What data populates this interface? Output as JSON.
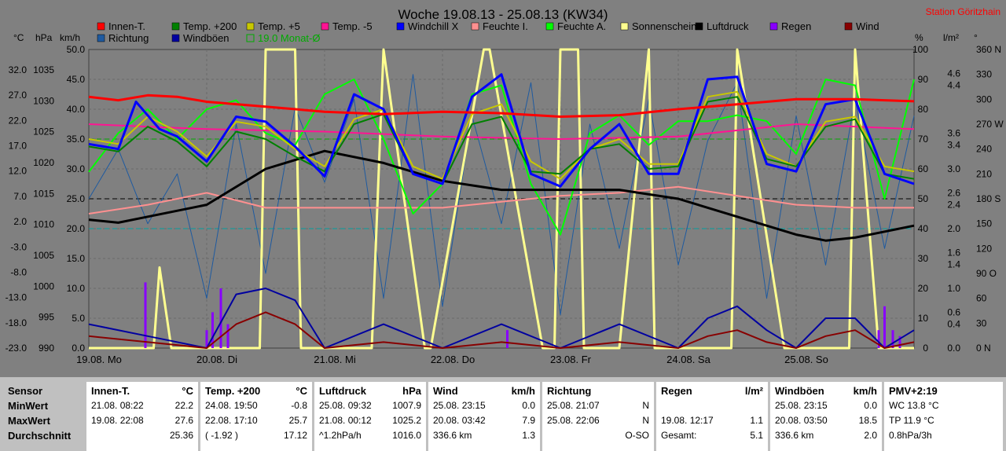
{
  "chart_data": {
    "type": "line",
    "title": "Woche 19.08.13 - 25.08.13 (KW34)",
    "station": "Station Göritzhain",
    "axis_units": {
      "celsius": "°C",
      "hpa": "hPa",
      "kmh": "km/h",
      "percent": "%",
      "lm2": "l/m²",
      "deg": "°"
    },
    "axes": {
      "celsius": [
        "32.0",
        "27.0",
        "22.0",
        "17.0",
        "12.0",
        "7.0",
        "2.0",
        "-3.0",
        "-8.0",
        "-13.0",
        "-18.0",
        "-23.0"
      ],
      "hpa": [
        "1035",
        "1030",
        "1025",
        "1020",
        "1015",
        "1010",
        "1005",
        "1000",
        "995",
        "990"
      ],
      "kmh": [
        "50.0",
        "45.0",
        "40.0",
        "35.0",
        "30.0",
        "25.0",
        "20.0",
        "15.0",
        "10.0",
        "5.0",
        "0.0"
      ],
      "percent": [
        "100",
        "90",
        "80",
        "70",
        "60",
        "50",
        "40",
        "30",
        "20",
        "10",
        "0"
      ],
      "lm2": [
        "4.6",
        "4.4",
        "3.6",
        "3.4",
        "3.0",
        "2.6",
        "2.4",
        "2.0",
        "1.6",
        "1.4",
        "1.0",
        "0.6",
        "0.4",
        "0.0"
      ],
      "direction": [
        "360 N",
        "330",
        "300",
        "270 W",
        "240",
        "210",
        "180 S",
        "150",
        "120",
        "90 O",
        "60",
        "30",
        "0 N"
      ]
    },
    "x_days": [
      "19.08. Mo",
      "20.08. Di",
      "21.08. Mi",
      "22.08. Do",
      "23.08. Fr",
      "24.08. Sa",
      "25.08. So"
    ],
    "legend": [
      {
        "name": "Innen-T.",
        "color": "#ff0000"
      },
      {
        "name": "Temp. +200",
        "color": "#008000"
      },
      {
        "name": "Temp. +5",
        "color": "#c8c800"
      },
      {
        "name": "Temp. -5",
        "color": "#ff1493"
      },
      {
        "name": "Windchill X",
        "color": "#0000ff"
      },
      {
        "name": "Feuchte I.",
        "color": "#ff9090"
      },
      {
        "name": "Feuchte A.",
        "color": "#00ff00"
      },
      {
        "name": "Sonnenschein",
        "color": "#ffff90"
      },
      {
        "name": "Luftdruck",
        "color": "#000000"
      },
      {
        "name": "Regen",
        "color": "#8800ff"
      },
      {
        "name": "Wind",
        "color": "#880000"
      },
      {
        "name": "Richtung",
        "color": "#1e5aa0"
      },
      {
        "name": "Windböen",
        "color": "#0000a0"
      },
      {
        "name": "19.0 Monat-Ø",
        "color": "#00aa00"
      }
    ],
    "x_unit": "day",
    "series": [
      {
        "name": "Innen-T.",
        "unit": "°C",
        "x": [
          0,
          0.25,
          0.5,
          0.75,
          1,
          1.5,
          2,
          2.5,
          3,
          3.5,
          4,
          4.5,
          5,
          5.5,
          6,
          6.25,
          6.5,
          6.75,
          7
        ],
        "values": [
          27.5,
          26.8,
          27.8,
          27.5,
          26.5,
          25.5,
          24.5,
          24.0,
          24.5,
          24.2,
          23.5,
          23.8,
          25.0,
          26.0,
          27.0,
          27.0,
          27.0,
          26.8,
          26.6
        ]
      },
      {
        "name": "Temp. +200",
        "unit": "°C",
        "x": [
          0,
          0.25,
          0.5,
          0.75,
          1,
          1.25,
          1.5,
          1.75,
          2,
          2.25,
          2.5,
          2.75,
          3,
          3.25,
          3.5,
          3.75,
          4,
          4.25,
          4.5,
          4.75,
          5,
          5.25,
          5.5,
          5.75,
          6,
          6.25,
          6.5,
          6.75,
          7
        ],
        "values": [
          17.5,
          16.5,
          21.5,
          18.5,
          13.5,
          20.5,
          19.0,
          15.5,
          12.5,
          22.0,
          24.0,
          12.0,
          10.0,
          22.0,
          23.5,
          12.5,
          12.0,
          17.0,
          18.0,
          13.0,
          13.5,
          26.5,
          27.5,
          15.0,
          13.5,
          21.5,
          23.0,
          12.0,
          11.0
        ]
      },
      {
        "name": "Temp. +5",
        "unit": "°C",
        "x": [
          0,
          0.25,
          0.5,
          0.75,
          1,
          1.25,
          1.5,
          1.75,
          2,
          2.25,
          2.5,
          2.75,
          3,
          3.25,
          3.5,
          3.75,
          4,
          4.25,
          4.5,
          4.75,
          5,
          5.25,
          5.5,
          5.75,
          6,
          6.25,
          6.5,
          6.75,
          7
        ],
        "values": [
          19.0,
          18.0,
          23.5,
          20.5,
          15.5,
          22.5,
          21.5,
          17.0,
          13.5,
          23.0,
          25.0,
          13.5,
          11.0,
          24.0,
          26.0,
          14.5,
          11.0,
          17.0,
          19.0,
          14.0,
          14.0,
          27.5,
          28.5,
          16.0,
          13.5,
          22.5,
          23.5,
          13.5,
          12.5
        ]
      },
      {
        "name": "Temp. -5",
        "unit": "°C",
        "x": [
          0,
          1,
          2,
          3,
          4,
          5,
          6,
          7
        ],
        "values": [
          22.0,
          21.0,
          20.5,
          19.5,
          19.0,
          19.5,
          22.0,
          21.0
        ]
      },
      {
        "name": "Windchill X",
        "unit": "°C",
        "x": [
          0,
          0.25,
          0.4,
          0.6,
          0.75,
          1,
          1.25,
          1.5,
          1.75,
          2,
          2.25,
          2.5,
          2.75,
          3,
          3.25,
          3.5,
          3.75,
          4,
          4.25,
          4.5,
          4.75,
          5,
          5.25,
          5.5,
          5.75,
          6,
          6.25,
          6.5,
          6.75,
          7
        ],
        "values": [
          18.0,
          17.0,
          26.5,
          21.0,
          19.5,
          14.5,
          23.5,
          22.5,
          17.5,
          11.5,
          28.0,
          25.0,
          12.0,
          10.0,
          27.5,
          32.0,
          12.0,
          9.5,
          17.0,
          22.0,
          12.0,
          12.0,
          31.0,
          31.5,
          14.0,
          12.5,
          26.0,
          27.0,
          12.0,
          10.0
        ]
      },
      {
        "name": "Feuchte I.",
        "unit": "%",
        "x": [
          0,
          0.5,
          1,
          1.5,
          2,
          2.5,
          3,
          3.5,
          4,
          4.5,
          5,
          5.5,
          6,
          6.5,
          7
        ],
        "values": [
          45,
          48,
          52,
          47,
          47,
          47,
          47,
          49,
          51,
          52,
          54,
          51,
          48,
          47,
          47
        ]
      },
      {
        "name": "Feuchte A.",
        "unit": "%",
        "x": [
          0,
          0.25,
          0.5,
          0.75,
          1,
          1.25,
          1.5,
          1.75,
          2,
          2.25,
          2.5,
          2.75,
          3,
          3.25,
          3.5,
          3.75,
          4,
          4.25,
          4.5,
          4.75,
          5,
          5.25,
          5.5,
          5.75,
          6,
          6.25,
          6.5,
          6.75,
          7
        ],
        "values": [
          59,
          72,
          80,
          70,
          80,
          83,
          72,
          68,
          85,
          90,
          70,
          45,
          55,
          85,
          88,
          55,
          38,
          72,
          78,
          68,
          76,
          76,
          78,
          76,
          65,
          90,
          88,
          50,
          90
        ]
      },
      {
        "name": "Luftdruck",
        "unit": "hPa",
        "x": [
          0,
          0.25,
          0.5,
          1,
          1.5,
          2,
          2.5,
          3,
          3.5,
          4,
          4.5,
          5,
          5.5,
          6,
          6.25,
          6.5,
          6.75,
          7
        ],
        "values": [
          1011.5,
          1011,
          1012,
          1014,
          1020,
          1023,
          1021,
          1018,
          1016.5,
          1016.5,
          1016.5,
          1015,
          1012,
          1009,
          1008,
          1008.5,
          1009.5,
          1010.5
        ]
      },
      {
        "name": "Sonnenschein",
        "unit": "%",
        "x": [
          0,
          0.55,
          0.6,
          0.7,
          0.72,
          1.05,
          1.45,
          1.5,
          1.75,
          1.8,
          2.4,
          2.5,
          2.85,
          2.9,
          3.35,
          3.4,
          3.85,
          3.95,
          4.0,
          4.15,
          4.2,
          4.45,
          4.5,
          4.75,
          4.8,
          5.45,
          5.5,
          5.9,
          5.95,
          6.45,
          6.5,
          6.7,
          6.75,
          7
        ],
        "values": [
          0,
          0,
          27,
          0,
          0,
          0,
          0,
          100,
          100,
          0,
          0,
          100,
          0,
          0,
          100,
          100,
          0,
          0,
          100,
          100,
          0,
          0,
          0,
          100,
          0,
          0,
          100,
          0,
          0,
          0,
          100,
          0,
          0,
          0
        ]
      },
      {
        "name": "Wind",
        "unit": "km/h",
        "x": [
          0,
          0.5,
          1,
          1.25,
          1.5,
          1.75,
          2,
          2.5,
          3,
          3.5,
          4,
          4.5,
          5,
          5.25,
          5.5,
          5.75,
          6,
          6.25,
          6.5,
          6.75,
          7
        ],
        "values": [
          2,
          1,
          0,
          4,
          6,
          4,
          0,
          1,
          0,
          1,
          0,
          1,
          0,
          2,
          3,
          1,
          0,
          2,
          3,
          0,
          1
        ]
      },
      {
        "name": "Windböen",
        "unit": "km/h",
        "x": [
          0,
          0.5,
          1,
          1.25,
          1.5,
          1.75,
          2,
          2.5,
          3,
          3.5,
          4,
          4.5,
          5,
          5.25,
          5.5,
          5.75,
          6,
          6.25,
          6.5,
          6.75,
          7
        ],
        "values": [
          4,
          2,
          0,
          9,
          10,
          8,
          0,
          4,
          0,
          4,
          0,
          4,
          0,
          5,
          7,
          3,
          0,
          5,
          5,
          0,
          3
        ]
      },
      {
        "name": "Regen",
        "unit": "l/m²",
        "bars": true,
        "x": [
          0.48,
          1.0,
          1.05,
          1.12,
          1.18,
          3.55,
          6.7,
          6.75,
          6.82,
          6.88
        ],
        "values": [
          1.1,
          0.3,
          0.6,
          1.0,
          0.4,
          0.3,
          0.3,
          0.7,
          0.3,
          0.2
        ]
      },
      {
        "name": "Richtung",
        "unit": "°",
        "x": [
          0,
          0.25,
          0.5,
          0.75,
          1,
          1.25,
          1.5,
          1.75,
          2,
          2.25,
          2.5,
          2.75,
          3,
          3.25,
          3.5,
          3.75,
          4,
          4.25,
          4.5,
          4.75,
          5,
          5.25,
          5.5,
          5.75,
          6,
          6.25,
          6.5,
          6.75,
          7
        ],
        "values": [
          180,
          240,
          150,
          210,
          60,
          270,
          90,
          290,
          200,
          300,
          60,
          330,
          50,
          280,
          150,
          320,
          40,
          270,
          120,
          300,
          100,
          250,
          320,
          60,
          280,
          100,
          300,
          120,
          280
        ]
      }
    ],
    "reference_lines": [
      {
        "name": "19.0 Monat-Ø",
        "unit": "°C",
        "value": 19.0,
        "color": "#00aa00"
      },
      {
        "unit": "km/h",
        "value": 25.0,
        "color": "#000000"
      },
      {
        "unit": "km/h",
        "value": 20.0,
        "color": "#00a0a0"
      }
    ]
  },
  "stats": {
    "sensor": {
      "label": "Sensor",
      "rows": [
        "MinWert",
        "MaxWert",
        "Durchschnitt"
      ]
    },
    "panels": [
      {
        "title": "Innen-T.",
        "unit": "°C",
        "rows": [
          {
            "left": "21.08. 08:22",
            "right": "22.2"
          },
          {
            "left": "19.08. 22:08",
            "right": "27.6"
          },
          {
            "left": "",
            "right": "25.36"
          }
        ]
      },
      {
        "title": "Temp. +200",
        "unit": "°C",
        "rows": [
          {
            "left": "24.08. 19:50",
            "right": "-0.8"
          },
          {
            "left": "22.08. 17:10",
            "right": "25.7"
          },
          {
            "left": "( -1.92 )",
            "right": "17.12"
          }
        ]
      },
      {
        "title": "Luftdruck",
        "unit": "hPa",
        "rows": [
          {
            "left": "25.08. 09:32",
            "right": "1007.9"
          },
          {
            "left": "21.08. 00:12",
            "right": "1025.2"
          },
          {
            "left": "^1.2hPa/h",
            "right": "1016.0"
          }
        ]
      },
      {
        "title": "Wind",
        "unit": "km/h",
        "rows": [
          {
            "left": "25.08. 23:15",
            "right": "0.0"
          },
          {
            "left": "20.08. 03:42",
            "right": "7.9"
          },
          {
            "left": "336.6 km",
            "right": "1.3"
          }
        ]
      },
      {
        "title": "Richtung",
        "unit": "",
        "rows": [
          {
            "left": "25.08. 21:07",
            "right": "N"
          },
          {
            "left": "25.08. 22:06",
            "right": "N"
          },
          {
            "left": "",
            "right": "O-SO"
          }
        ]
      },
      {
        "title": "Regen",
        "unit": "l/m²",
        "rows": [
          {
            "left": "",
            "right": ""
          },
          {
            "left": "19.08. 12:17",
            "right": "1.1"
          },
          {
            "left": "Gesamt:",
            "right": "5.1"
          }
        ]
      },
      {
        "title": "Windböen",
        "unit": "km/h",
        "rows": [
          {
            "left": "25.08. 23:15",
            "right": "0.0"
          },
          {
            "left": "20.08. 03:50",
            "right": "18.5"
          },
          {
            "left": "336.6 km",
            "right": "2.0"
          }
        ]
      },
      {
        "title": "PMV+2:19",
        "unit": "",
        "rows": [
          {
            "left": "WC 13.8 °C",
            "right": ""
          },
          {
            "left": "TP 11.9 °C",
            "right": ""
          },
          {
            "left": "0.8hPa/3h",
            "right": ""
          }
        ]
      }
    ]
  }
}
